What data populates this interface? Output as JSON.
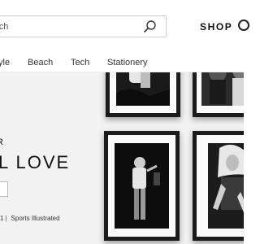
{
  "header": {
    "search": {
      "placeholder": "arch",
      "value": ""
    },
    "shop_label": "SHOP"
  },
  "nav": {
    "items": [
      "yle",
      "Beach",
      "Tech",
      "Stationery"
    ]
  },
  "hero": {
    "kicker": "R",
    "headline": "L LOVE",
    "meta": {
      "left": "1",
      "source": "Sports Illustrated"
    }
  },
  "icons": {
    "search": "search-icon",
    "cta": "arrow-right-icon",
    "cut_header": "circle-icon"
  }
}
